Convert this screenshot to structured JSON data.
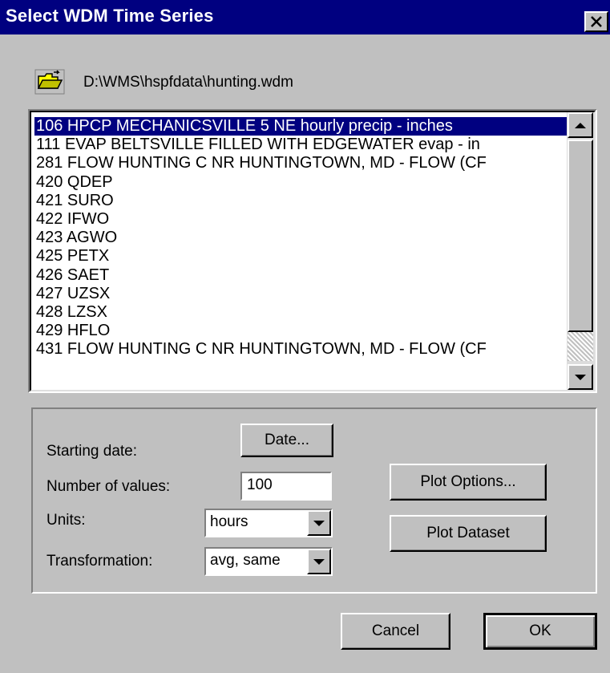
{
  "window": {
    "title": "Select WDM Time Series",
    "close_glyph": "✕",
    "colors": {
      "titlebar": "#000080",
      "face": "#c0c0c0",
      "selection": "#000080"
    }
  },
  "file": {
    "icon": "open-folder-icon",
    "path": "D:\\WMS\\hspfdata\\hunting.wdm"
  },
  "timeseries_list": {
    "selected_index": 0,
    "items": [
      "106 HPCP MECHANICSVILLE 5 NE hourly precip - inches",
      "111 EVAP BELTSVILLE FILLED WITH EDGEWATER evap - in",
      "281 FLOW HUNTING C NR HUNTINGTOWN, MD - FLOW (CF",
      "420 QDEP",
      "421 SURO",
      "422 IFWO",
      "423 AGWO",
      "425 PETX",
      "426 SAET",
      "427 UZSX",
      "428 LZSX",
      "429 HFLO",
      "431 FLOW HUNTING C NR HUNTINGTOWN, MD - FLOW (CF"
    ]
  },
  "options": {
    "starting_date_label": "Starting date:",
    "date_button": "Date...",
    "num_values_label": "Number of values:",
    "num_values": "100",
    "units_label": "Units:",
    "units_value": "hours",
    "transformation_label": "Transformation:",
    "transformation_value": "avg, same",
    "plot_options_button": "Plot Options...",
    "plot_dataset_button": "Plot Dataset"
  },
  "footer": {
    "cancel_button": "Cancel",
    "ok_button": "OK"
  }
}
